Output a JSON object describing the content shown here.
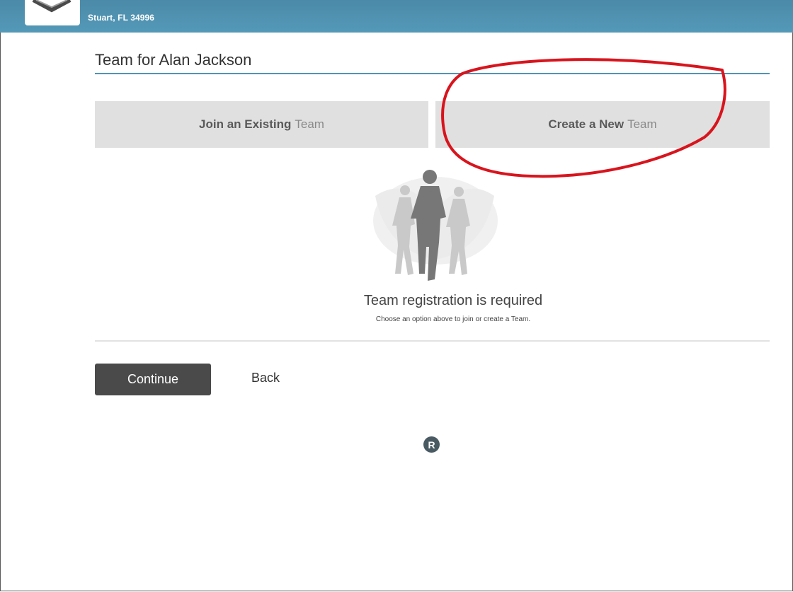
{
  "header": {
    "subtitle": "Stuart, FL 34996",
    "truncated_title": "",
    "logo_icon": "event-logo-icon",
    "colors": {
      "bar": "#4f91b0"
    }
  },
  "page": {
    "title": "Team for Alan Jackson",
    "accent_color": "#4d94b8"
  },
  "options": {
    "join": {
      "bold": "Join an Existing",
      "light": "Team"
    },
    "create": {
      "bold": "Create a New",
      "light": "Team"
    }
  },
  "annotation": {
    "icon": "red-circle-annotation",
    "color": "#d8141d"
  },
  "empty_state": {
    "icon": "runners-illustration-icon",
    "title": "Team registration is required",
    "subtitle": "Choose an option above to join or create a Team."
  },
  "actions": {
    "continue_label": "Continue",
    "back_label": "Back"
  },
  "footer": {
    "badge": "R"
  }
}
